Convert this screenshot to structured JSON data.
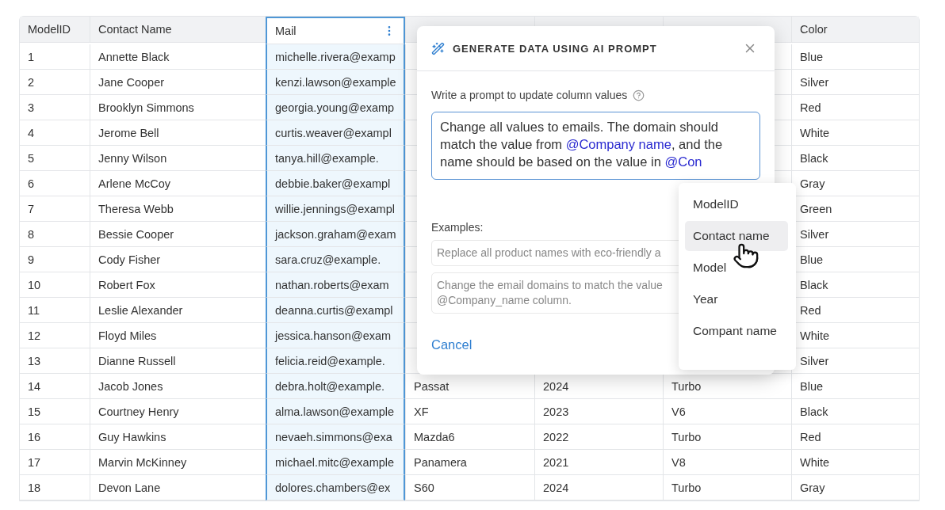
{
  "table": {
    "columns": [
      {
        "label": "ModelID",
        "selected": false
      },
      {
        "label": "Contact Name",
        "selected": false
      },
      {
        "label": "Mail",
        "selected": true
      },
      {
        "selected": false
      },
      {
        "selected": false
      },
      {
        "selected": false
      },
      {
        "label": "Color",
        "selected": false
      }
    ],
    "rows": [
      {
        "cells": [
          "1",
          "Annette Black",
          "michelle.rivera@examp",
          null,
          null,
          null,
          "Blue"
        ]
      },
      {
        "cells": [
          "2",
          "Jane Cooper",
          "kenzi.lawson@example",
          null,
          null,
          null,
          "Silver"
        ]
      },
      {
        "cells": [
          "3",
          "Brooklyn Simmons",
          "georgia.young@examp",
          null,
          null,
          null,
          "Red"
        ]
      },
      {
        "cells": [
          "4",
          "Jerome Bell",
          "curtis.weaver@exampl",
          null,
          null,
          null,
          "White"
        ]
      },
      {
        "cells": [
          "5",
          "Jenny Wilson",
          "tanya.hill@example.",
          null,
          null,
          null,
          "Black"
        ]
      },
      {
        "cells": [
          "6",
          "Arlene McCoy",
          "debbie.baker@exampl",
          null,
          null,
          null,
          "Gray"
        ]
      },
      {
        "cells": [
          "7",
          "Theresa Webb",
          "willie.jennings@exampl",
          null,
          null,
          null,
          "Green"
        ]
      },
      {
        "cells": [
          "8",
          "Bessie Cooper",
          "jackson.graham@exam",
          null,
          null,
          null,
          "Silver"
        ]
      },
      {
        "cells": [
          "9",
          "Cody Fisher",
          "sara.cruz@example.",
          null,
          null,
          null,
          "Blue"
        ]
      },
      {
        "cells": [
          "10",
          "Robert Fox",
          "nathan.roberts@exam",
          null,
          null,
          null,
          "Black"
        ]
      },
      {
        "cells": [
          "11",
          "Leslie Alexander",
          "deanna.curtis@exampl",
          null,
          null,
          null,
          "Red"
        ]
      },
      {
        "cells": [
          "12",
          "Floyd Miles",
          "jessica.hanson@exam",
          null,
          null,
          null,
          "White"
        ]
      },
      {
        "cells": [
          "13",
          "Dianne Russell",
          "felicia.reid@example.",
          null,
          null,
          null,
          "Silver"
        ]
      },
      {
        "cells": [
          "14",
          "Jacob Jones",
          "debra.holt@example.",
          "Passat",
          "2024",
          "Turbo",
          "Blue"
        ]
      },
      {
        "cells": [
          "15",
          "Courtney Henry",
          "alma.lawson@example",
          "XF",
          "2023",
          "V6",
          "Black"
        ]
      },
      {
        "cells": [
          "16",
          "Guy Hawkins",
          "nevaeh.simmons@exa",
          "Mazda6",
          "2022",
          "Turbo",
          "Red"
        ]
      },
      {
        "cells": [
          "17",
          "Marvin McKinney",
          "michael.mitc@example",
          "Panamera",
          "2021",
          "V8",
          "White"
        ]
      },
      {
        "cells": [
          "18",
          "Devon Lane",
          "dolores.chambers@ex",
          "S60",
          "2024",
          "Turbo",
          "Gray"
        ]
      }
    ]
  },
  "dialog": {
    "title": "GENERATE DATA USING AI PROMPT",
    "prompt_label": "Write a prompt to update column values",
    "prompt": [
      {
        "kind": "plain",
        "text": "Change all values to emails. The domain should match the value from "
      },
      {
        "kind": "mention",
        "text": "@Company name"
      },
      {
        "kind": "plain",
        "text": ", and the name should be based on the value in "
      },
      {
        "kind": "mention",
        "text": "@Con"
      }
    ],
    "examples_label": "Examples:",
    "examples": [
      "Replace all product names with eco-friendly a",
      "Change the email domains to match the value\n@Company_name column."
    ],
    "cancel": "Cancel"
  },
  "mention_menu": [
    {
      "label": "ModelID",
      "highlighted": false
    },
    {
      "label": "Contact name",
      "highlighted": true
    },
    {
      "label": "Model",
      "highlighted": false
    },
    {
      "label": "Year",
      "highlighted": false
    },
    {
      "label": "Compant name",
      "highlighted": false
    }
  ]
}
